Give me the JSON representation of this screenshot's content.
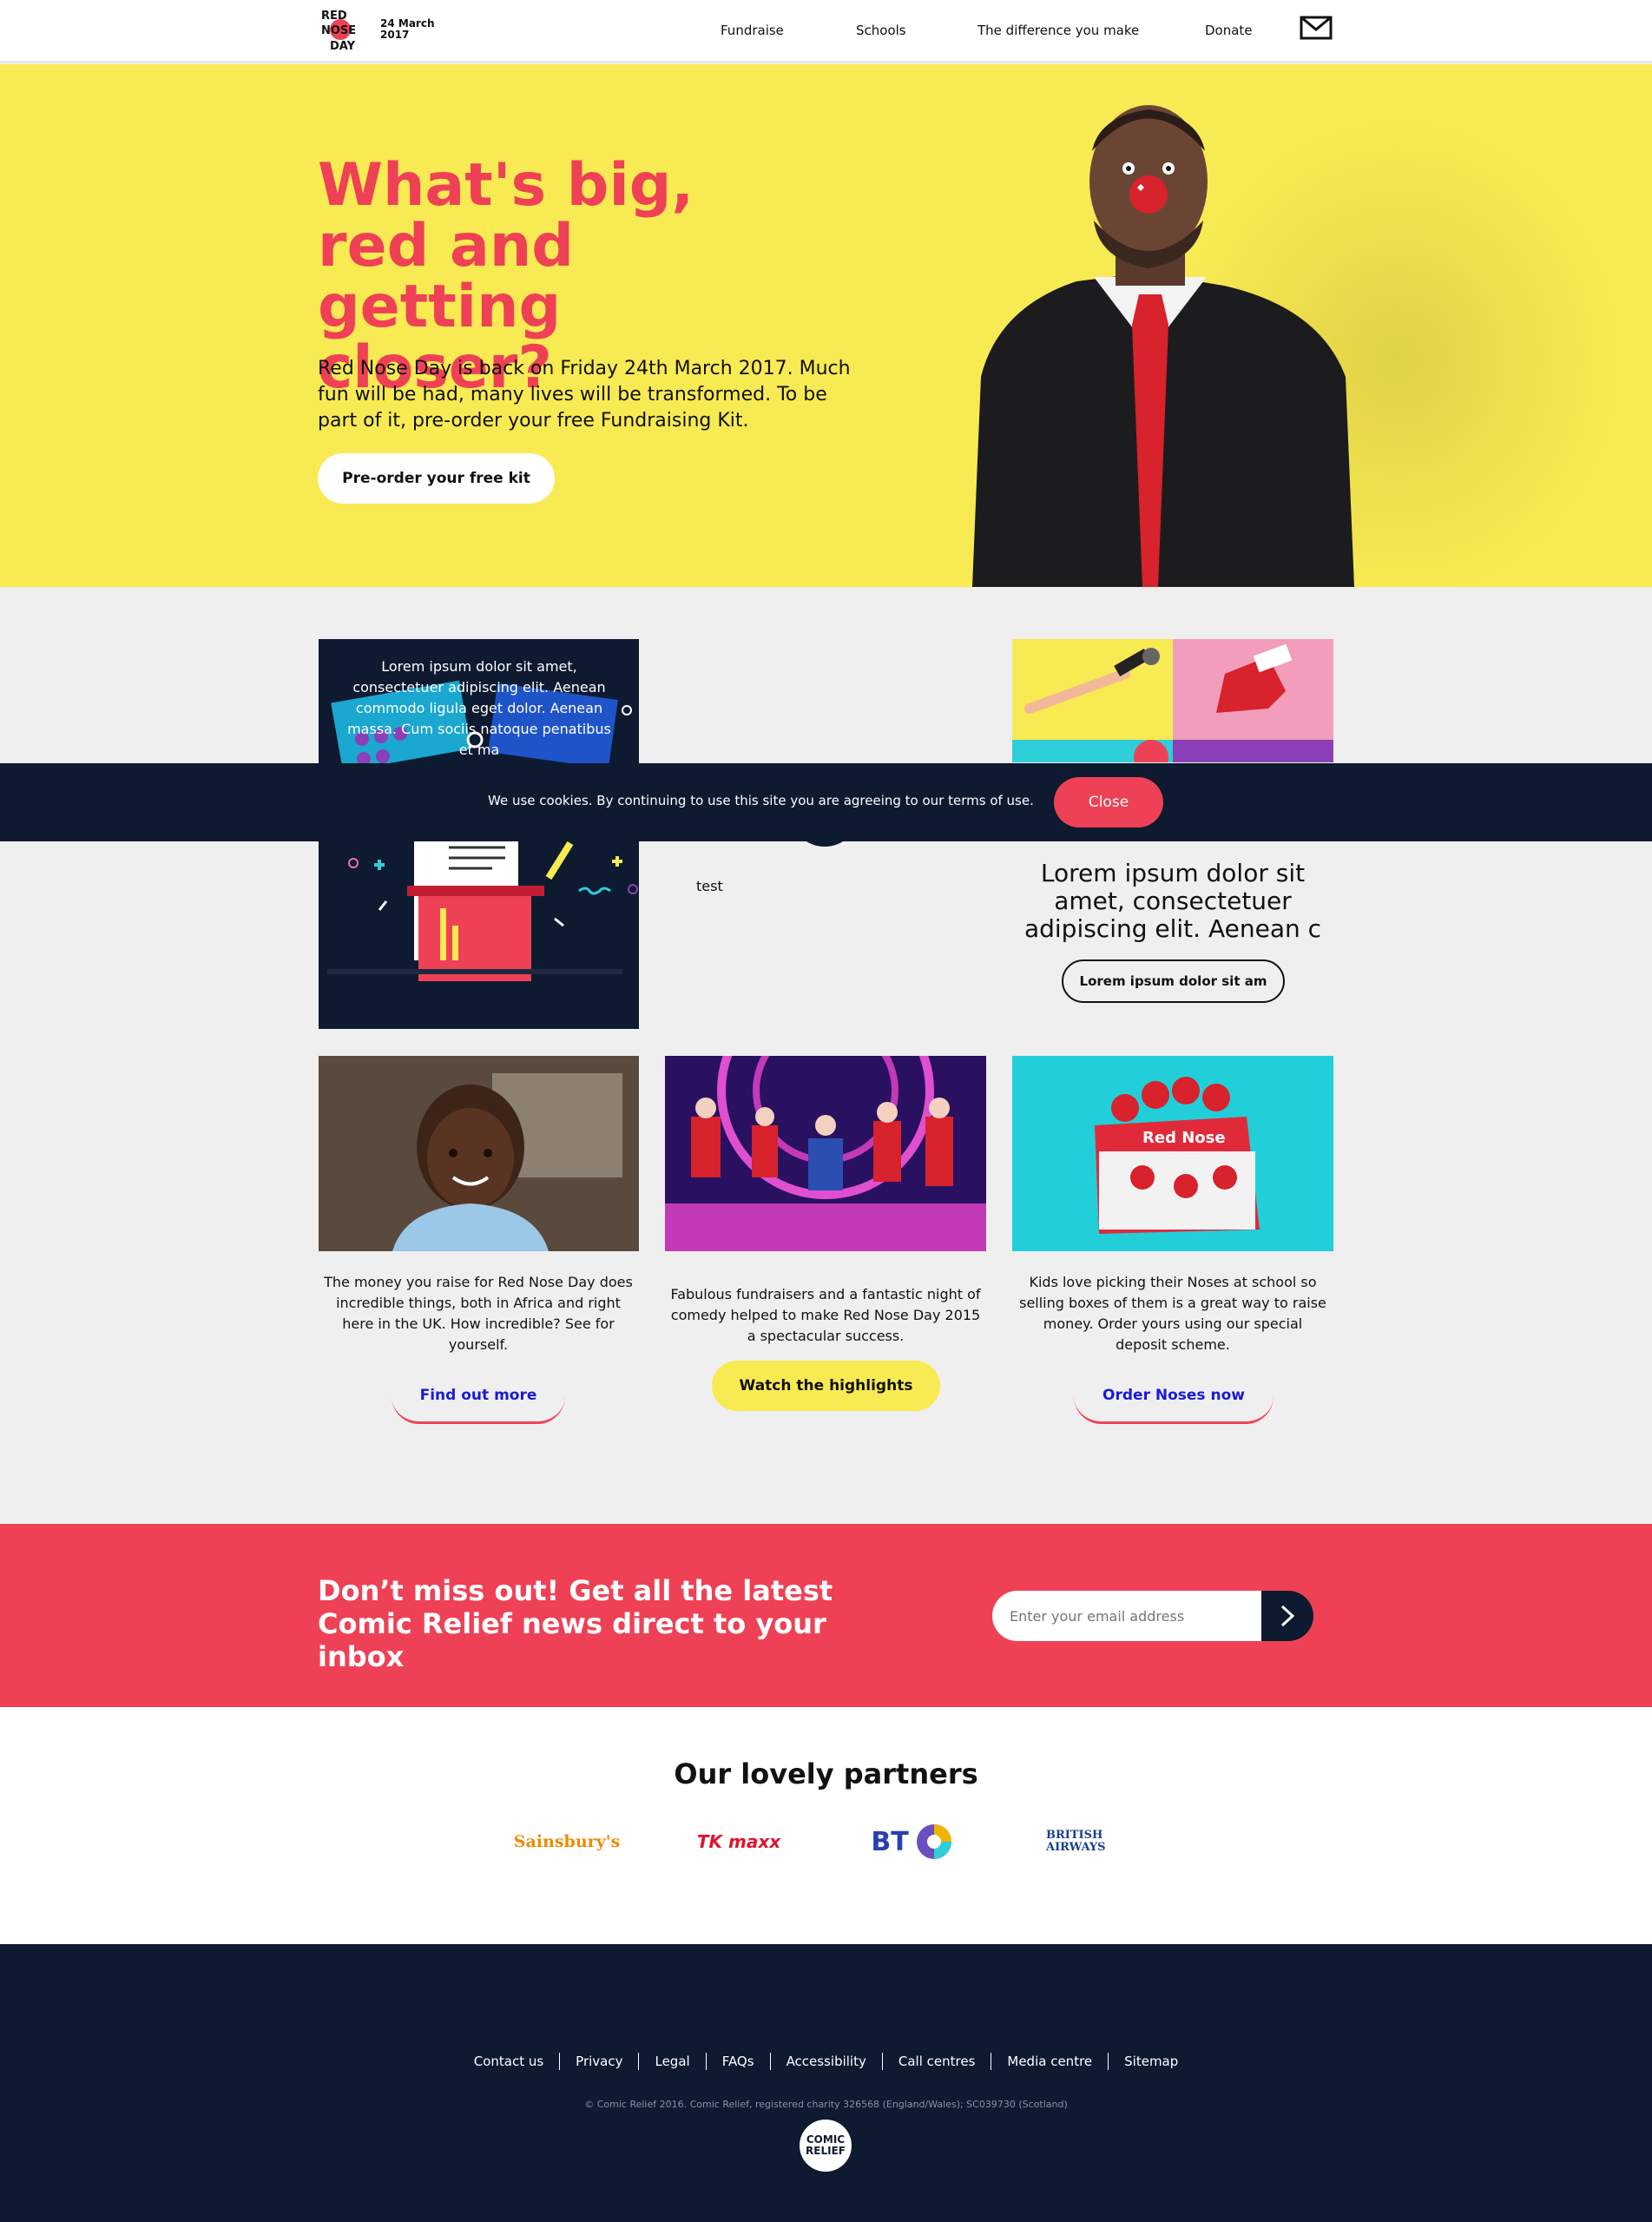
{
  "header": {
    "logo_text": "RED NOSE DAY",
    "logo_date": "24 March 2017",
    "nav": [
      "Fundraise",
      "Schools",
      "The difference you make",
      "Donate"
    ]
  },
  "hero": {
    "title": "What's big, red and getting closer?",
    "text": "Red Nose Day is back on Friday 24th March 2017. Much fun will be had, many lives will be transformed. To be part of it, pre-order your free Fundraising Kit.",
    "button": "Pre-order your free kit"
  },
  "cards": {
    "tile1_text": "Lorem ipsum dolor sit amet, consectetuer adipiscing elit. Aenean commodo ligula eget dolor. Aenean massa. Cum sociis natoque penatibus et ma",
    "mid_text": "test",
    "tile3_title": "Lorem ipsum dolor sit amet, consectetuer adipiscing elit. Aenean c",
    "tile3_button": "Lorem ipsum dolor sit am"
  },
  "cookie": {
    "text": "We use cookies. By continuing to use this site you are agreeing to our terms of use.",
    "button": "Close"
  },
  "features": [
    {
      "text": "The money you raise for Red Nose Day does incredible things, both in Africa and right here in the UK. How incredible? See for yourself.",
      "button": "Find out more"
    },
    {
      "text": "Fabulous fundraisers and a fantastic night of comedy helped to make Red Nose Day 2015 a spectacular success.",
      "button": "Watch the highlights"
    },
    {
      "text": "Kids love picking their Noses at school so selling boxes of them is a great way to raise money. Order yours using our special deposit scheme.",
      "button": "Order Noses now"
    }
  ],
  "newsletter": {
    "title": "Don’t miss out! Get all the latest Comic Relief news direct to your inbox",
    "placeholder": "Enter your email address"
  },
  "partners": {
    "title": "Our lovely partners",
    "logos": [
      "Sainsbury's",
      "TK maxx",
      "BT",
      "BRITISH AIRWAYS"
    ]
  },
  "footer": {
    "links": [
      "Contact us",
      "Privacy",
      "Legal",
      "FAQs",
      "Accessibility",
      "Call centres",
      "Media centre",
      "Sitemap"
    ],
    "copyright": "© Comic Relief 2016. Comic Relief, registered charity 326568 (England/Wales); SC039730 (Scotland)",
    "logo": "COMIC RELIEF"
  },
  "colors": {
    "red": "#ef4156",
    "yellow": "#f8ea52",
    "navy": "#0d1a30",
    "link_blue": "#1a1ad4"
  }
}
